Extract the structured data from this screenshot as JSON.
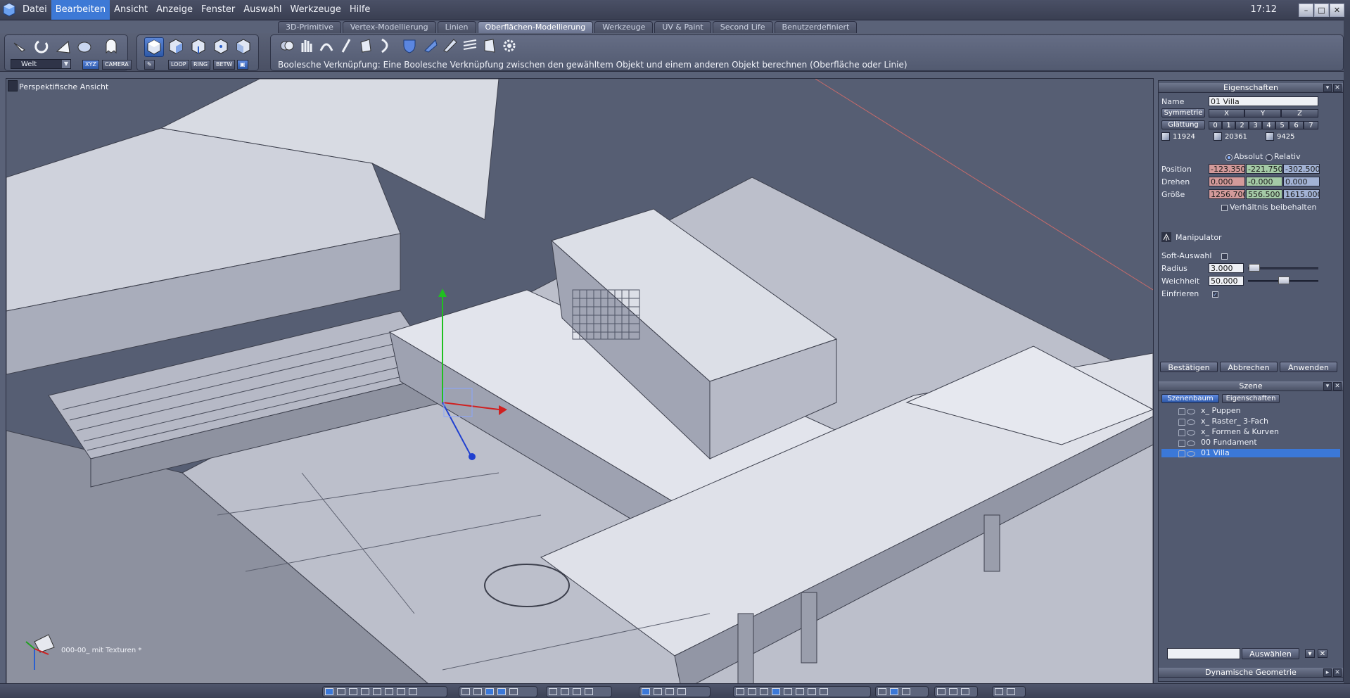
{
  "menu": {
    "items": [
      "Datei",
      "Bearbeiten",
      "Ansicht",
      "Anzeige",
      "Fenster",
      "Auswahl",
      "Werkzeuge",
      "Hilfe"
    ],
    "active_index": 1,
    "clock": "17:12"
  },
  "tabs": {
    "items": [
      "3D-Primitive",
      "Vertex-Modellierung",
      "Linien",
      "Oberflächen-Modellierung",
      "Werkzeuge",
      "UV & Paint",
      "Second Life",
      "Benutzerdefiniert"
    ],
    "active_index": 3
  },
  "toolbar": {
    "coord_system": "Welt",
    "xyz_label": "XYZ",
    "camera_label": "CAMERA",
    "loop_label": "LOOP",
    "ring_label": "RING",
    "betw_label": "BETW",
    "status": "Boolesche Verknüpfung: Eine Boolesche Verknüpfung zwischen den gewähltem Objekt und einem anderen Objekt berechnen (Oberfläche oder Linie)"
  },
  "viewport": {
    "label": "Perspektifische Ansicht",
    "file_label": "000-00_ mit Texturen *"
  },
  "properties": {
    "title": "Eigenschaften",
    "name_label": "Name",
    "name_value": "01 Villa",
    "symmetrie_label": "Symmetrie",
    "axes": [
      "X",
      "Y",
      "Z"
    ],
    "glaettung_label": "Glättung",
    "glaettung_levels": [
      "0",
      "1",
      "2",
      "3",
      "4",
      "5",
      "6",
      "7"
    ],
    "stats": [
      "11924",
      "20361",
      "9425"
    ],
    "absolut_label": "Absolut",
    "relativ_label": "Relativ",
    "position_label": "Position",
    "position": [
      "-123.350",
      "-221.750",
      "-302.500"
    ],
    "drehen_label": "Drehen",
    "drehen": [
      "0.000",
      "-0.000",
      "0.000"
    ],
    "groesse_label": "Größe",
    "groesse": [
      "1256.700",
      "556.500",
      "1615.000"
    ],
    "verhaeltnis_label": "Verhältnis beibehalten",
    "manipulator_label": "Manipulator",
    "soft_auswahl_label": "Soft-Auswahl",
    "radius_label": "Radius",
    "radius_value": "3.000",
    "weichheit_label": "Weichheit",
    "weichheit_value": "50.000",
    "einfrieren_label": "Einfrieren",
    "einfrieren_mark": "✓",
    "bestaetigen_label": "Bestätigen",
    "abbrechen_label": "Abbrechen",
    "anwenden_label": "Anwenden"
  },
  "scene": {
    "title": "Szene",
    "tab_tree": "Szenenbaum",
    "tab_props": "Eigenschaften",
    "items": [
      "x_ Puppen",
      "x_ Raster_ 3-Fach",
      "x_ Formen & Kurven",
      "00 Fundament",
      "01 Villa"
    ],
    "selected_index": 4,
    "select_button": "Auswählen",
    "dyn_geom": "Dynamische Geometrie"
  },
  "colors": {
    "accent": "#3b78d8",
    "panel": "#525a70",
    "viewport": "#565e73"
  }
}
